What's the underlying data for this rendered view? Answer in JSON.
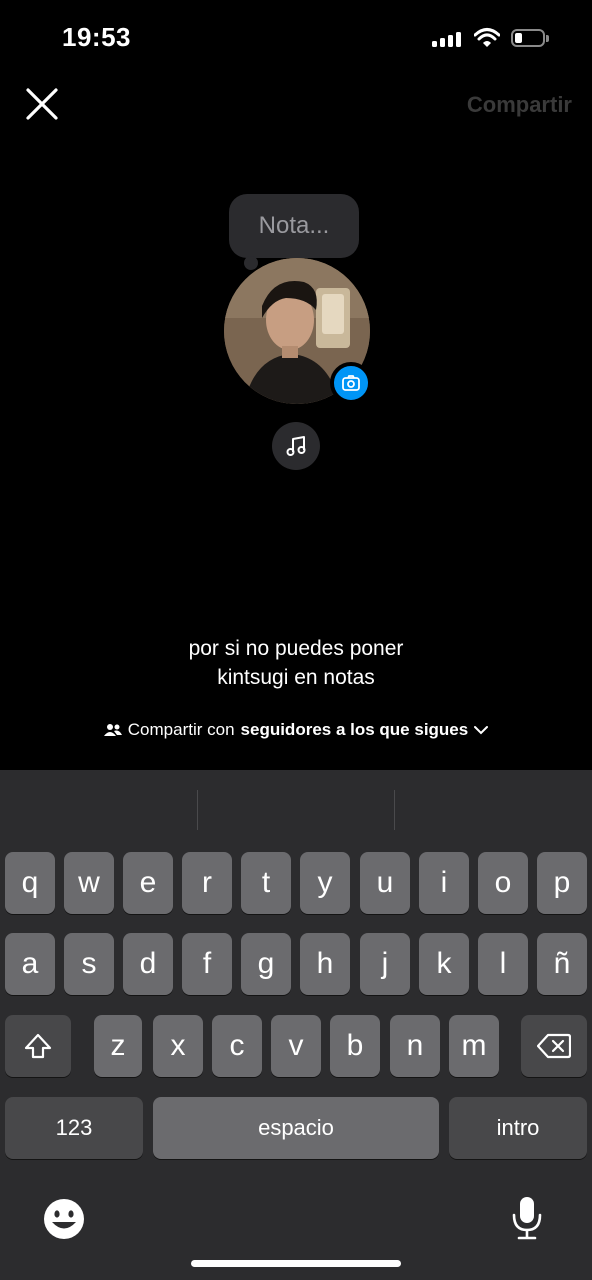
{
  "status_bar": {
    "time": "19:53"
  },
  "nav": {
    "share_label": "Compartir"
  },
  "note": {
    "placeholder": "Nota..."
  },
  "caption": {
    "line1": "por si no puedes poner",
    "line2": "kintsugi en notas"
  },
  "audience": {
    "prefix": "Compartir con",
    "value": "seguidores a los que sigues"
  },
  "keyboard": {
    "row1": [
      "q",
      "w",
      "e",
      "r",
      "t",
      "y",
      "u",
      "i",
      "o",
      "p"
    ],
    "row2": [
      "a",
      "s",
      "d",
      "f",
      "g",
      "h",
      "j",
      "k",
      "l",
      "ñ"
    ],
    "row3": [
      "z",
      "x",
      "c",
      "v",
      "b",
      "n",
      "m"
    ],
    "numbers_label": "123",
    "space_label": "espacio",
    "return_label": "intro"
  },
  "icons": [
    "close-icon",
    "camera-icon",
    "music-note-icon",
    "people-icon",
    "chevron-down-icon",
    "shift-icon",
    "backspace-icon",
    "emoji-icon",
    "microphone-icon"
  ]
}
